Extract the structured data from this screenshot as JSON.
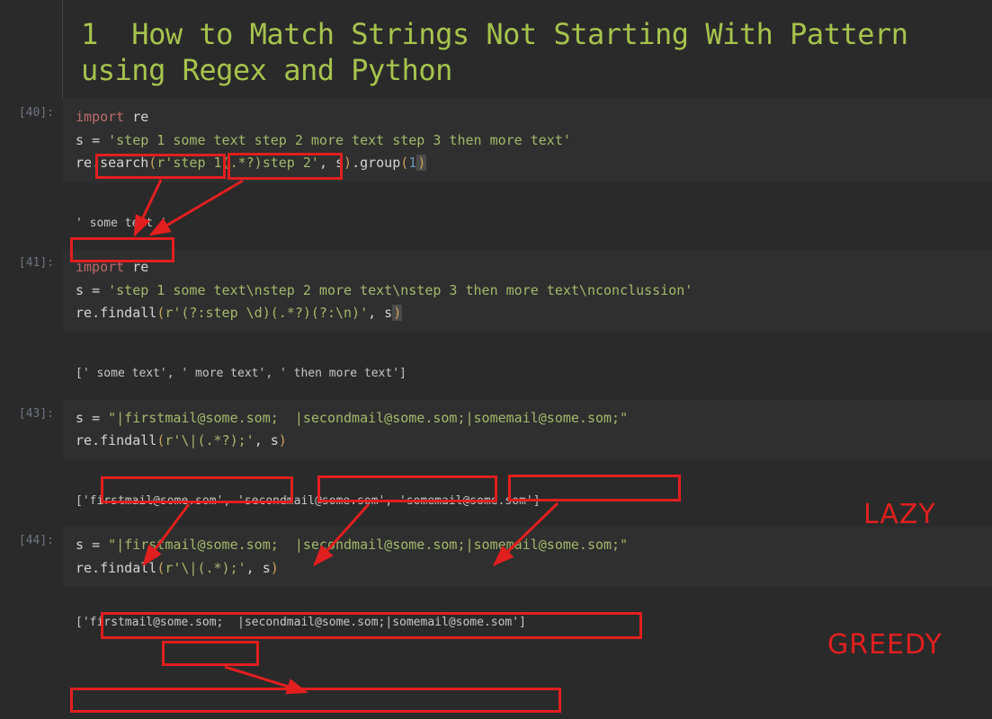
{
  "title_number": "1",
  "title_text": "How to Match Strings Not Starting With Pattern using Regex and Python",
  "cells": [
    {
      "prompt": "[40]:",
      "code": [
        "import re",
        "s = 'step 1 some text step 2 more text step 3 then more text'",
        "re.search(r'step 1(.*?)step 2', s).group(1)"
      ],
      "output": "' some text '"
    },
    {
      "prompt": "[41]:",
      "code": [
        "import re",
        "s = 'step 1 some text\\nstep 2 more text\\nstep 3 then more text\\nconclussion'",
        "re.findall(r'(?:step \\d)(.*?)(?:\\n)', s)"
      ],
      "output": "[' some text', ' more text', ' then more text']"
    },
    {
      "prompt": "[43]:",
      "code": [
        "s = \"|firstmail@some.som;  |secondmail@some.som;|somemail@some.som;\"",
        "re.findall(r'\\|(.*?);', s)"
      ],
      "output": "['firstmail@some.som', 'secondmail@some.som', 'somemail@some.som']"
    },
    {
      "prompt": "[44]:",
      "code": [
        "s = \"|firstmail@some.som;  |secondmail@some.som;|somemail@some.som;\"",
        "re.findall(r'\\|(.*);', s)"
      ],
      "output": "['firstmail@some.som;  |secondmail@some.som;|somemail@some.som']"
    }
  ],
  "labels": {
    "lazy": "LAZY",
    "greedy": "GREEDY"
  }
}
